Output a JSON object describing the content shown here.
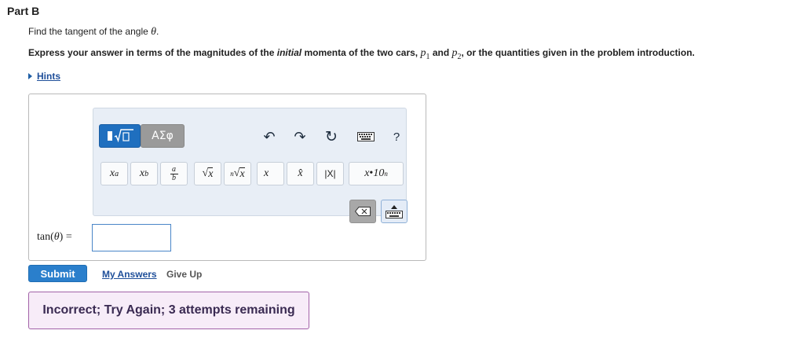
{
  "part": {
    "title": "Part B"
  },
  "question": {
    "text": "Find the tangent of the angle",
    "symbol": "θ",
    "end": "."
  },
  "instruction": {
    "pre": "Express your answer in terms of the magnitudes of the",
    "emph": "initial",
    "mid": "momenta of the two cars,",
    "p1": "p",
    "p1_sub": "1",
    "and": "and",
    "p2": "p",
    "p2_sub": "2",
    "post": ", or the quantities given in the problem introduction."
  },
  "hints": {
    "label": "Hints"
  },
  "toolbar": {
    "greek_label": "ΑΣφ",
    "undo": "↶",
    "redo": "↷",
    "reset": "↻",
    "help": "?",
    "keys": [
      {
        "name": "superscript-key",
        "label": "xᵃ"
      },
      {
        "name": "subscript-key",
        "label": "x_b"
      },
      {
        "name": "fraction-key",
        "label": "a/b"
      },
      {
        "name": "sqrt-key",
        "label": "√x"
      },
      {
        "name": "nth-root-key",
        "label": "ⁿ√x"
      },
      {
        "name": "vector-key",
        "label": "x⃗"
      },
      {
        "name": "unit-vector-key",
        "label": "x̂"
      },
      {
        "name": "abs-key",
        "label": "|X|"
      },
      {
        "name": "sci-notation-key",
        "label": "x•10ⁿ"
      }
    ]
  },
  "answer": {
    "label_fn": "tan",
    "label_var": "θ",
    "label_eq": " =",
    "value": ""
  },
  "actions": {
    "submit": "Submit",
    "my_answers": "My Answers",
    "give_up": "Give Up"
  },
  "feedback": {
    "text": "Incorrect; Try Again; 3 attempts remaining"
  },
  "colors": {
    "accent": "#2a7fcc",
    "link": "#1f4f9a",
    "feedback_bg": "#f7ecf8",
    "feedback_border": "#a262a8"
  }
}
